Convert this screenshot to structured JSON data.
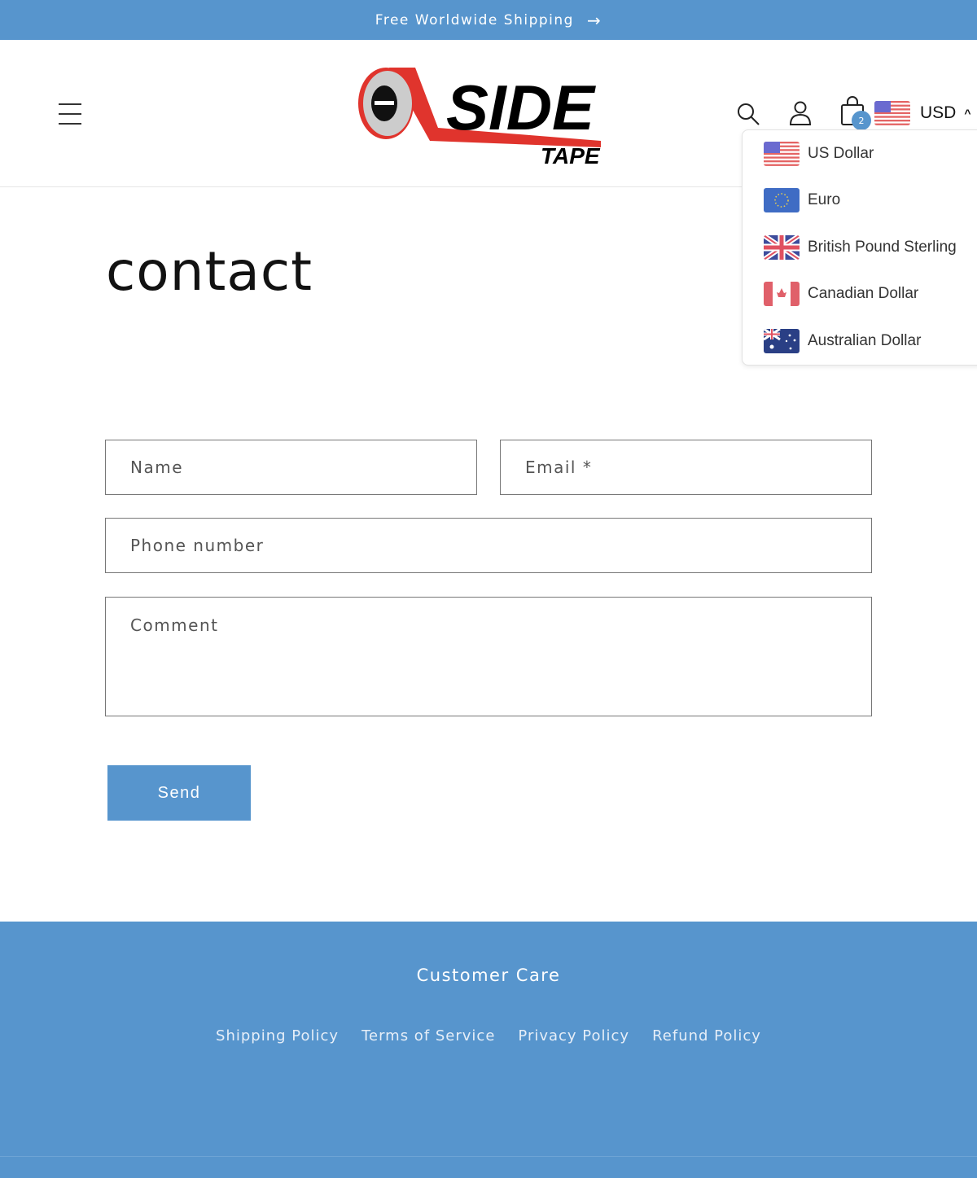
{
  "announcement": {
    "text": "Free Worldwide Shipping",
    "arrow": "→"
  },
  "header": {
    "logo": {
      "word1": "SIDE",
      "word2": "TAPE"
    },
    "cart_count": "2",
    "currency": {
      "selected": "USD",
      "selected_flag": "us",
      "chevron": "^",
      "options": [
        {
          "label": "US Dollar",
          "flag": "us"
        },
        {
          "label": "Euro",
          "flag": "eu"
        },
        {
          "label": "British Pound Sterling",
          "flag": "gb"
        },
        {
          "label": "Canadian Dollar",
          "flag": "ca"
        },
        {
          "label": "Australian Dollar",
          "flag": "au"
        }
      ]
    }
  },
  "main": {
    "title": "contact",
    "form": {
      "name": "Name",
      "email": "Email *",
      "phone": "Phone number",
      "comment": "Comment",
      "send": "Send"
    }
  },
  "footer": {
    "heading": "Customer Care",
    "links": [
      "Shipping Policy",
      "Terms of Service",
      "Privacy Policy",
      "Refund Policy"
    ]
  },
  "colors": {
    "brand": "#5795cd",
    "logo_red": "#e0342d"
  }
}
